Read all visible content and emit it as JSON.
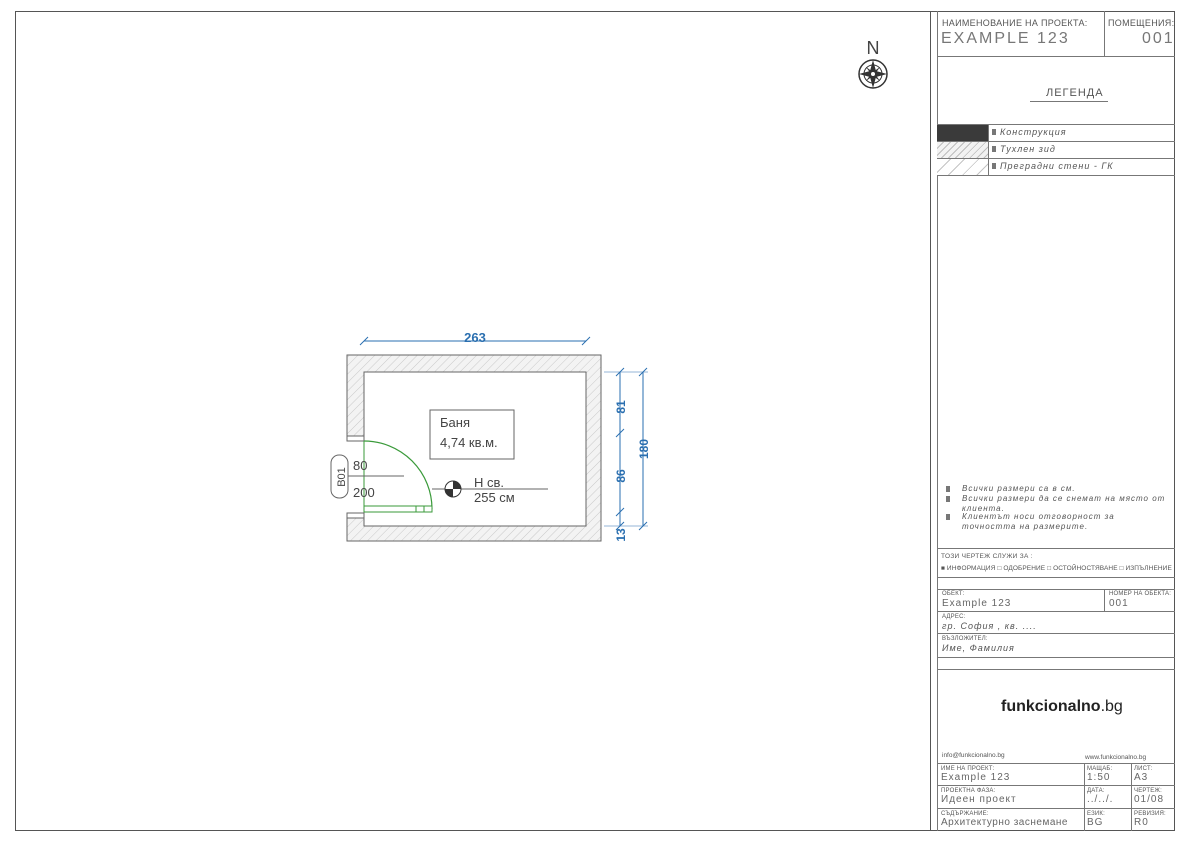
{
  "title_block": {
    "project_label": "НАИМЕНОВАНИЕ НА ПРОЕКТА:",
    "project_value": "EXAMPLE 123",
    "rooms_label": "ПОМЕЩЕНИЯ:",
    "rooms_value": "001",
    "legend_title": "ЛЕГЕНДА",
    "legend_items": [
      "Конструкция",
      "Тухлен зид",
      "Преградни стени - ГК"
    ],
    "notes": [
      "Всички размери са в см.",
      "Всички размери да се снемат на място от клиента.",
      "Клиентът носи отговорност за точността на размерите."
    ],
    "purpose_label": "ТОЗИ ЧЕРТЕЖ СЛУЖИ ЗА :",
    "purpose_options": "■ ИНФОРМАЦИЯ □ ОДОБРЕНИЕ □ ОСТОЙНОСТЯВАНЕ □ ИЗПЪЛНЕНИЕ",
    "object_label": "ОБЕКТ:",
    "object_value": "Example 123",
    "object_no_label": "НОМЕР НА ОБЕКТА:",
    "object_no_value": "001",
    "address_label": "АДРЕС:",
    "address_value": "гр. София , кв. ....",
    "client_label": "ВЪЗЛОЖИТЕЛ:",
    "client_value": "Име, Фамилия",
    "brand_main": "funkcionalno",
    "brand_tld": ".bg",
    "email": "info@funkcionalno.bg",
    "website": "www.funkcionalno.bg",
    "project_name_label": "ИМЕ НА ПРОЕКТ:",
    "project_name_value": "Example 123",
    "scale_label": "МАЩАБ:",
    "scale_value": "1:50",
    "sheet_label": "ЛИСТ:",
    "sheet_value": "A3",
    "phase_label": "ПРОЕКТНА ФАЗА:",
    "phase_value": "Идеен проект",
    "date_label": "ДАТА:",
    "date_value": "../../.",
    "drawing_label": "ЧЕРТЕЖ:",
    "drawing_value": "01/08",
    "content_label": "СЪДЪРЖАНИЕ:",
    "content_value": "Архитектурно заснемане",
    "lang_label": "ЕЗИК:",
    "lang_value": "BG",
    "revision_label": "РЕВИЗИЯ:",
    "revision_value": "R0"
  },
  "plan": {
    "north": "N",
    "dim_width": "263",
    "dim_height": "180",
    "dim_upper": "81",
    "dim_middle": "86",
    "dim_lower": "13",
    "room_name": "Баня",
    "room_area": "4,74 кв.м.",
    "height_label": "Н св.",
    "height_value": "255 см",
    "door_tag": "В01",
    "door_width": "80",
    "door_height": "200"
  },
  "colors": {
    "dimension": "#2a6fb0",
    "door": "#3a9a3a",
    "wall_fill": "#ececec"
  }
}
